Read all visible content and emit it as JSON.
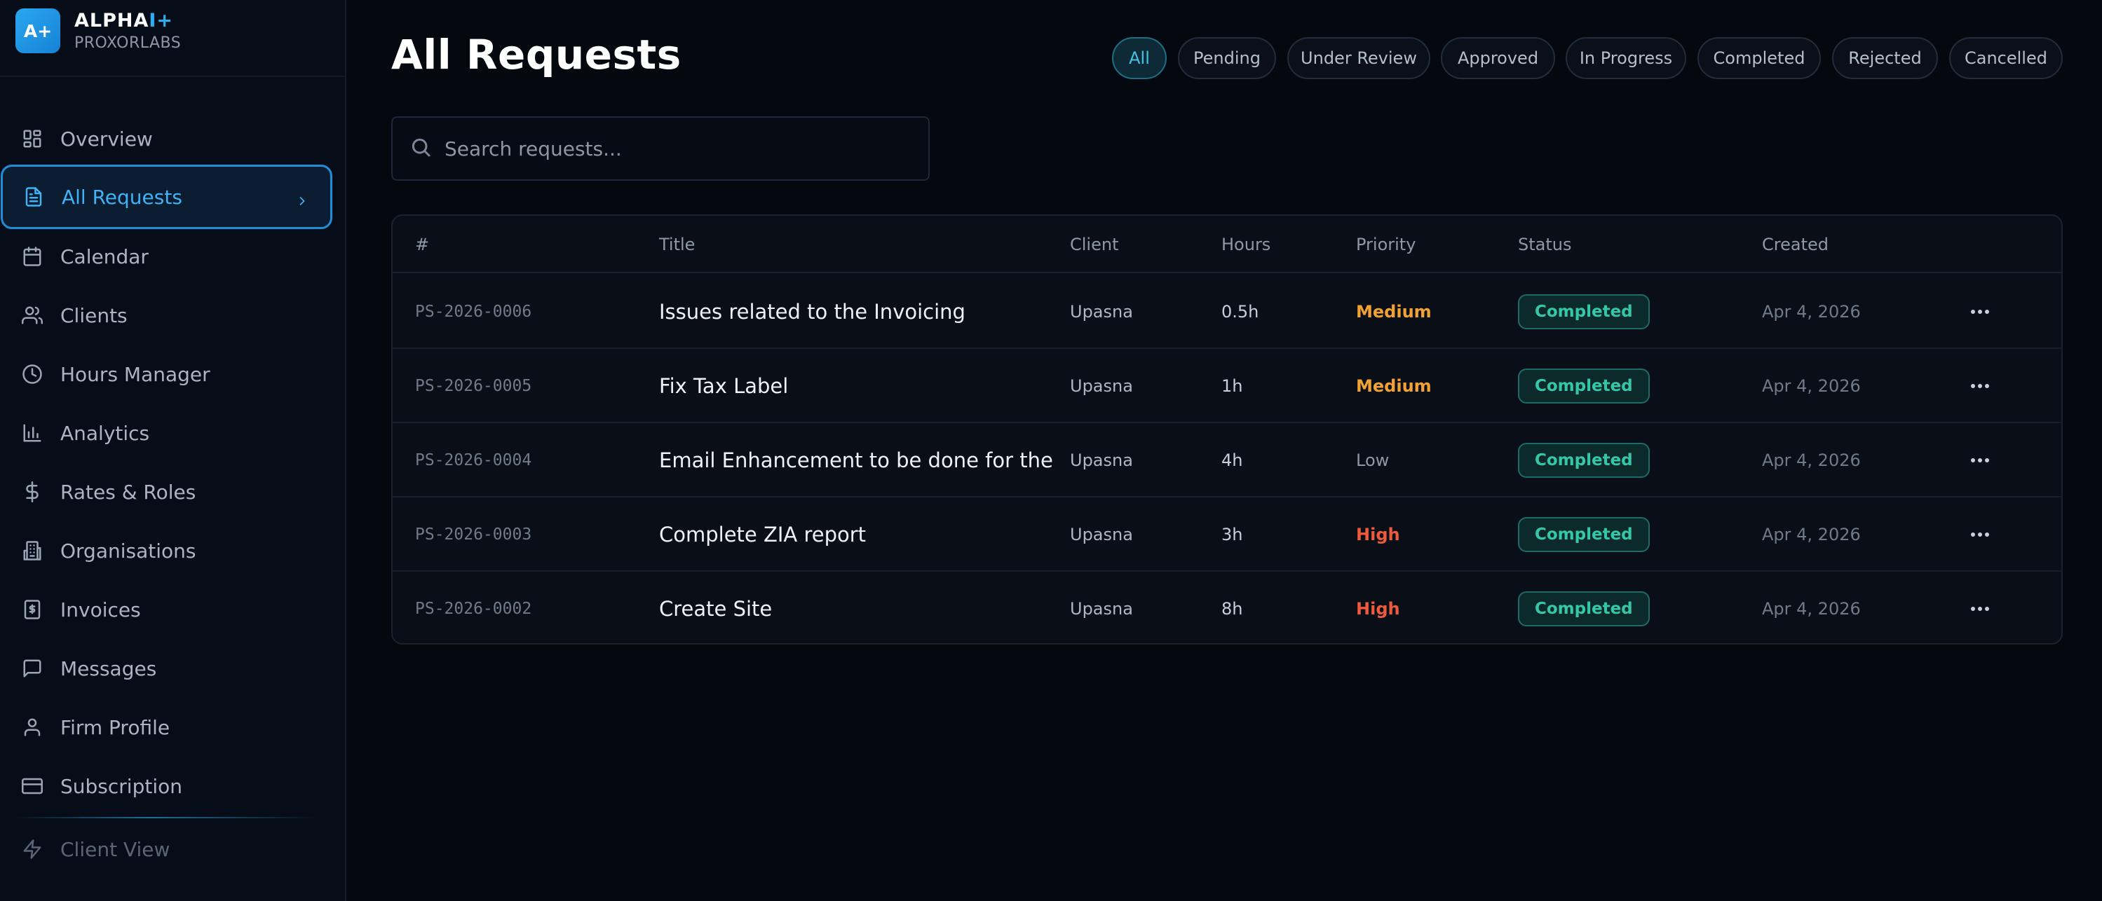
{
  "brand": {
    "logo_text": "A+",
    "name": "ALPHA",
    "name_accent": "I+",
    "subtitle": "PROXORLABS",
    "accent_color": "#2aa7ef"
  },
  "sidebar": {
    "items": [
      {
        "label": "Overview",
        "icon": "grid-icon"
      },
      {
        "label": "All Requests",
        "icon": "file-text-icon",
        "active": true
      },
      {
        "label": "Calendar",
        "icon": "calendar-icon"
      },
      {
        "label": "Clients",
        "icon": "users-icon"
      },
      {
        "label": "Hours Manager",
        "icon": "clock-icon"
      },
      {
        "label": "Analytics",
        "icon": "bar-chart-icon"
      },
      {
        "label": "Rates & Roles",
        "icon": "dollar-icon"
      },
      {
        "label": "Organisations",
        "icon": "building-icon"
      },
      {
        "label": "Invoices",
        "icon": "receipt-icon"
      },
      {
        "label": "Messages",
        "icon": "message-icon"
      },
      {
        "label": "Firm Profile",
        "icon": "user-icon"
      },
      {
        "label": "Subscription",
        "icon": "credit-card-icon"
      }
    ],
    "footer_item": {
      "label": "Client View",
      "icon": "lightning-icon"
    }
  },
  "page": {
    "title": "All Requests"
  },
  "filters": [
    {
      "label": "All",
      "active": true
    },
    {
      "label": "Pending"
    },
    {
      "label": "Under Review"
    },
    {
      "label": "Approved"
    },
    {
      "label": "In Progress"
    },
    {
      "label": "Completed"
    },
    {
      "label": "Rejected"
    },
    {
      "label": "Cancelled"
    }
  ],
  "search": {
    "placeholder": "Search requests...",
    "value": ""
  },
  "table": {
    "columns": [
      "#",
      "Title",
      "Client",
      "Hours",
      "Priority",
      "Status",
      "Created"
    ],
    "rows": [
      {
        "id": "PS-2026-0006",
        "title": "Issues related to the Invoicing",
        "client": "Upasna",
        "hours": "0.5h",
        "priority": "Medium",
        "status": "Completed",
        "created": "Apr 4, 2026"
      },
      {
        "id": "PS-2026-0005",
        "title": "Fix Tax Label",
        "client": "Upasna",
        "hours": "1h",
        "priority": "Medium",
        "status": "Completed",
        "created": "Apr 4, 2026"
      },
      {
        "id": "PS-2026-0004",
        "title": "Email Enhancement to be done for the ...",
        "client": "Upasna",
        "hours": "4h",
        "priority": "Low",
        "status": "Completed",
        "created": "Apr 4, 2026"
      },
      {
        "id": "PS-2026-0003",
        "title": "Complete ZIA report",
        "client": "Upasna",
        "hours": "3h",
        "priority": "High",
        "status": "Completed",
        "created": "Apr 4, 2026"
      },
      {
        "id": "PS-2026-0002",
        "title": "Create Site",
        "client": "Upasna",
        "hours": "8h",
        "priority": "High",
        "status": "Completed",
        "created": "Apr 4, 2026"
      }
    ]
  },
  "colors": {
    "background": "#05080f",
    "sidebar": "#070d18",
    "active_blue": "#3fb3f5",
    "priority_medium": "#f2a234",
    "priority_high": "#ee5a3c",
    "priority_low": "#8e98a7",
    "status_completed": "#35c7a7"
  }
}
